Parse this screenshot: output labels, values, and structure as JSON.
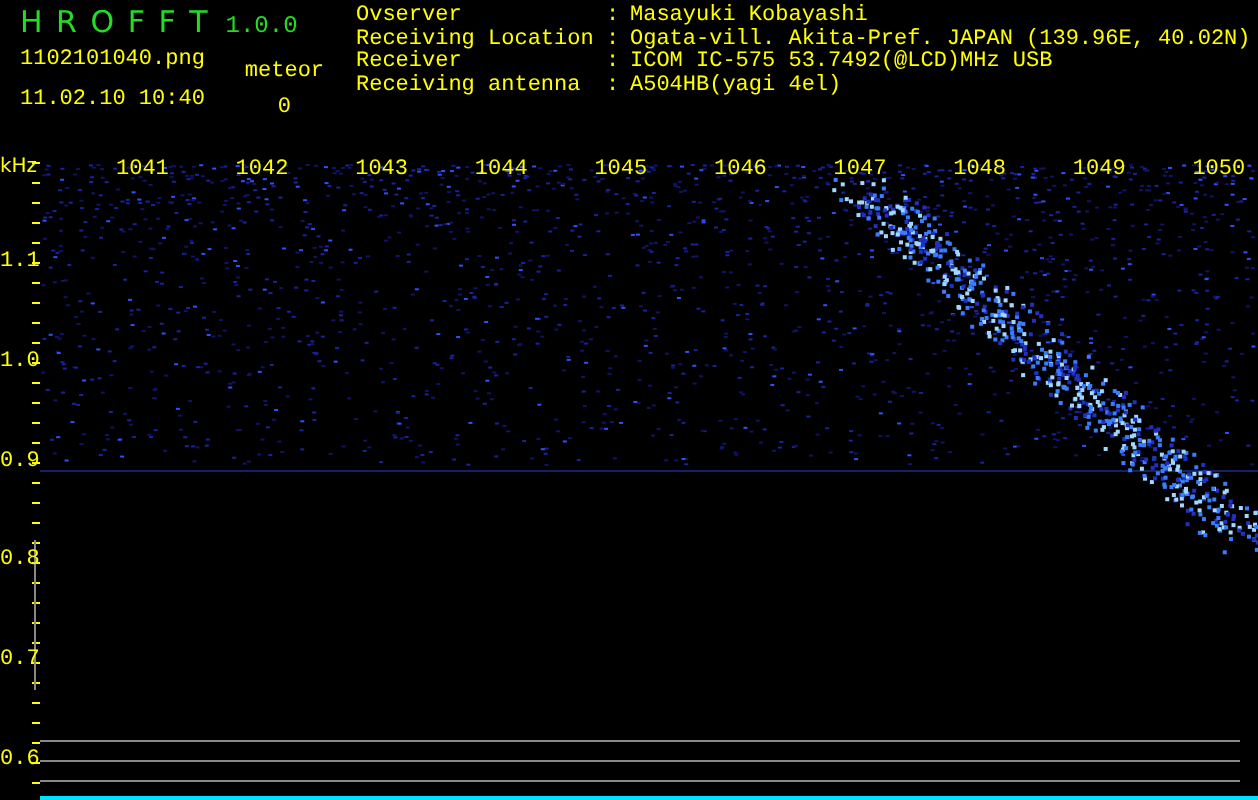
{
  "app": {
    "title": "H R O F F T",
    "version": "1.0.0"
  },
  "file": {
    "name": "1102101040.png",
    "datetime": "11.02.10 10:40"
  },
  "meteor": {
    "label": "meteor",
    "count": "0"
  },
  "station": [
    {
      "label": "Ovserver",
      "separator": ":",
      "value": "Masayuki Kobayashi"
    },
    {
      "label": "Receiving Location",
      "separator": ":",
      "value": "Ogata-vill. Akita-Pref. JAPAN (139.96E, 40.02N)"
    },
    {
      "label": "Receiver",
      "separator": ":",
      "value": "ICOM IC-575 53.7492(@LCD)MHz USB"
    },
    {
      "label": "Receiving antenna",
      "separator": ":",
      "value": "A504HB(yagi 4el)"
    }
  ],
  "spectrogram": {
    "unit": "kHz",
    "x_labels": [
      "1041",
      "1042",
      "1043",
      "1044",
      "1045",
      "1046",
      "1047",
      "1048",
      "1049",
      "1050"
    ],
    "y_labels": [
      "1.1",
      "1.0",
      "0.9",
      "0.8",
      "0.7",
      "0.6"
    ]
  }
}
